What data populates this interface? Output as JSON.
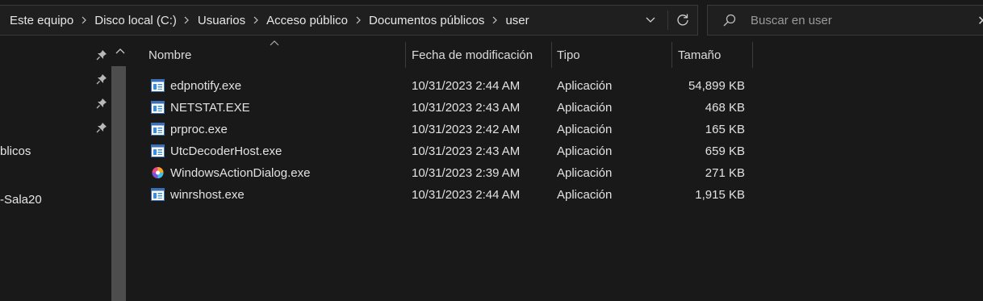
{
  "address_bar": {
    "breadcrumbs": [
      "Este equipo",
      "Disco local (C:)",
      "Usuarios",
      "Acceso público",
      "Documentos públicos",
      "user"
    ],
    "dropdown_icon": "chevron-down-icon",
    "refresh_icon": "refresh-icon"
  },
  "search": {
    "placeholder": "Buscar en user",
    "icon": "search-icon"
  },
  "nav_pane": {
    "items": [
      {
        "label": "blicos"
      },
      {
        "label": "-Sala20"
      }
    ],
    "pin_icon": "pin-icon"
  },
  "columns": {
    "name": "Nombre",
    "modified": "Fecha de modificación",
    "type": "Tipo",
    "size": "Tamaño"
  },
  "files": [
    {
      "name": "edpnotify.exe",
      "modified": "10/31/2023 2:44 AM",
      "type": "Aplicación",
      "size": "54,899 KB",
      "icon": "app-window-icon"
    },
    {
      "name": "NETSTAT.EXE",
      "modified": "10/31/2023 2:43 AM",
      "type": "Aplicación",
      "size": "468 KB",
      "icon": "app-window-icon"
    },
    {
      "name": "prproc.exe",
      "modified": "10/31/2023 2:42 AM",
      "type": "Aplicación",
      "size": "165 KB",
      "icon": "app-window-icon"
    },
    {
      "name": "UtcDecoderHost.exe",
      "modified": "10/31/2023 2:43 AM",
      "type": "Aplicación",
      "size": "659 KB",
      "icon": "app-window-icon"
    },
    {
      "name": "WindowsActionDialog.exe",
      "modified": "10/31/2023 2:39 AM",
      "type": "Aplicación",
      "size": "271 KB",
      "icon": "color-wheel-icon"
    },
    {
      "name": "winrshost.exe",
      "modified": "10/31/2023 2:44 AM",
      "type": "Aplicación",
      "size": "1,915 KB",
      "icon": "app-window-icon"
    }
  ],
  "colors": {
    "background": "#191919",
    "text": "#e2e2e2",
    "border": "#3a3a3a",
    "icon_blue": "#3b8ed8"
  }
}
